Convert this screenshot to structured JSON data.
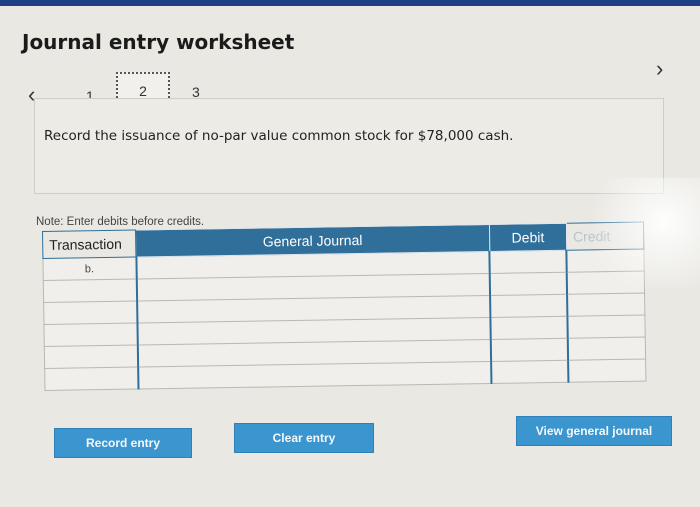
{
  "header": {
    "title": "Journal entry worksheet"
  },
  "nav": {
    "prev_icon": "‹",
    "next_icon": "›"
  },
  "steps": [
    {
      "label": "1"
    },
    {
      "label": "2",
      "active": true
    },
    {
      "label": "3"
    }
  ],
  "instruction": "Record the issuance of no-par value common stock for $78,000 cash.",
  "note": "Note: Enter debits before credits.",
  "table": {
    "headers": {
      "transaction": "Transaction",
      "general_journal": "General Journal",
      "debit": "Debit",
      "credit": "Credit"
    },
    "rows": [
      {
        "transaction": "b.",
        "account": "",
        "debit": "",
        "credit": ""
      },
      {
        "transaction": "",
        "account": "",
        "debit": "",
        "credit": ""
      },
      {
        "transaction": "",
        "account": "",
        "debit": "",
        "credit": ""
      },
      {
        "transaction": "",
        "account": "",
        "debit": "",
        "credit": ""
      },
      {
        "transaction": "",
        "account": "",
        "debit": "",
        "credit": ""
      },
      {
        "transaction": "",
        "account": "",
        "debit": "",
        "credit": ""
      }
    ]
  },
  "buttons": {
    "record": "Record entry",
    "clear": "Clear entry",
    "view": "View general journal"
  },
  "colors": {
    "accent": "#2f6f9a",
    "button": "#3b95cf",
    "topbar": "#1f3f86"
  }
}
